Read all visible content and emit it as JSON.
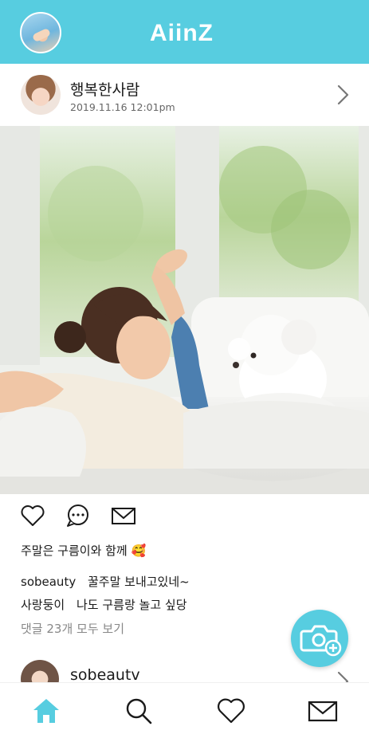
{
  "header": {
    "logo_text": "AiinZ",
    "bg_color": "#57cde0"
  },
  "post": {
    "username": "행복한사람",
    "date": "2019.11.16 12:01pm",
    "caption": "주말은 구름이와 함께",
    "caption_emoji": "🥰",
    "comments": [
      {
        "user": "sobeauty",
        "text": "꿀주말 보내고있네~"
      },
      {
        "user": "사랑둥이",
        "text": "나도 구름랑 놀고 싶당"
      }
    ],
    "view_all_comments": "댓글 23개 모두 보기"
  },
  "next_post": {
    "username": "sobeautv"
  },
  "icons": {
    "topbar": [
      "profile-avatar",
      "aiinz-logo"
    ],
    "actions": [
      "heart-icon",
      "comment-bubble-icon",
      "envelope-icon"
    ],
    "fab": "camera-plus-icon",
    "bottom_nav": [
      "home-icon",
      "search-icon",
      "heart-icon",
      "envelope-icon"
    ]
  },
  "colors": {
    "accent": "#57cde0",
    "text": "#1a1a1a",
    "muted": "#888888"
  }
}
